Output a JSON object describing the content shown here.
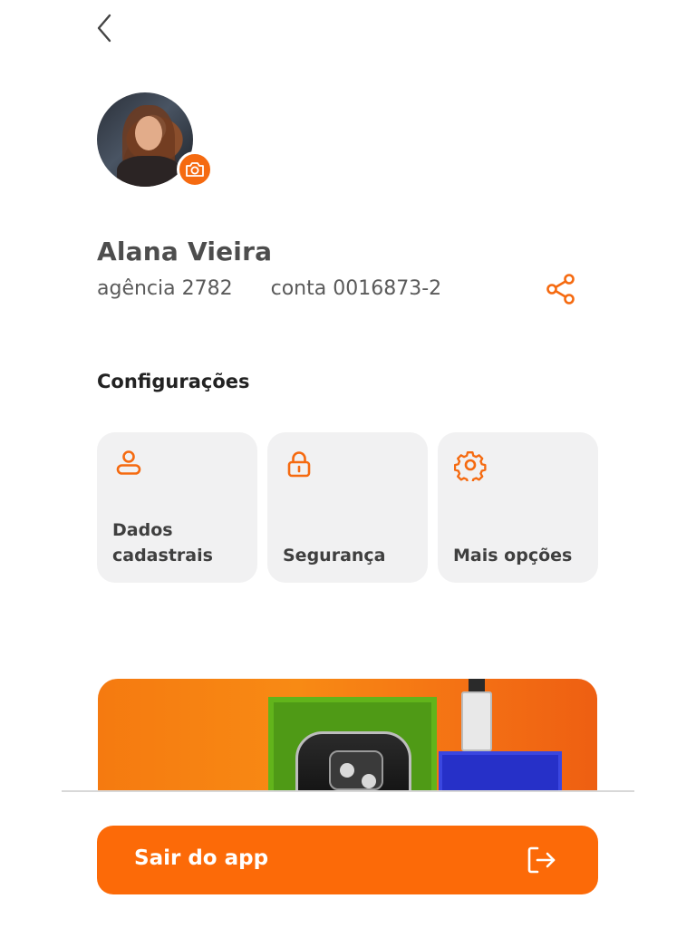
{
  "header": {
    "back_icon": "chevron-left-icon"
  },
  "profile": {
    "name": "Alana Vieira",
    "agency": "agência 2782",
    "account": "conta 0016873-2",
    "avatar_badge_icon": "camera-icon",
    "share_icon": "share-icon"
  },
  "settings": {
    "title": "Configurações",
    "cards": [
      {
        "label_line1": "Dados",
        "label_line2": "cadastrais",
        "icon": "user-icon"
      },
      {
        "label": "Segurança",
        "icon": "lock-icon"
      },
      {
        "label": "Mais opções",
        "icon": "gear-icon"
      }
    ]
  },
  "promo_banner": {
    "image": "promo-products-banner"
  },
  "footer": {
    "logout_label": "Sair do app",
    "logout_icon": "logout-icon"
  },
  "colors": {
    "accent": "#fc6a08",
    "card_bg": "#f1f1f2",
    "text": "#4d4d4d"
  }
}
